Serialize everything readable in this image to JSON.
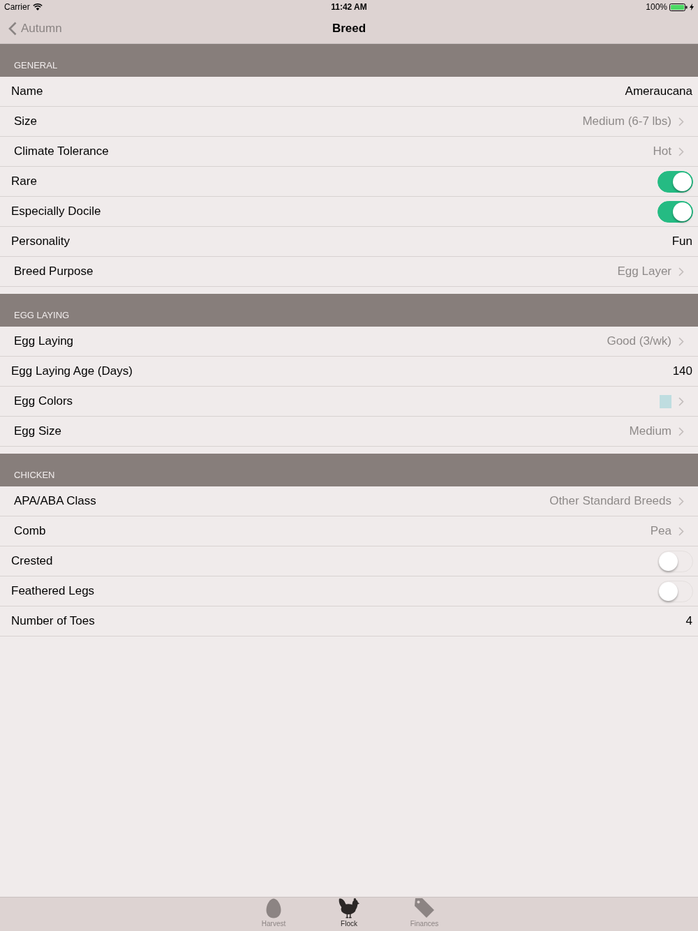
{
  "status_bar": {
    "carrier": "Carrier",
    "time": "11:42 AM",
    "battery": "100%"
  },
  "nav": {
    "back": "Autumn",
    "title": "Breed"
  },
  "sections": [
    {
      "title": "GENERAL",
      "rows": [
        {
          "kind": "text",
          "label": "Name",
          "value": "Ameraucana"
        },
        {
          "kind": "disclosure",
          "label": "Size",
          "value": "Medium (6-7 lbs)"
        },
        {
          "kind": "disclosure",
          "label": "Climate Tolerance",
          "value": "Hot"
        },
        {
          "kind": "toggle",
          "label": "Rare",
          "on": true
        },
        {
          "kind": "toggle",
          "label": "Especially Docile",
          "on": true
        },
        {
          "kind": "text",
          "label": "Personality",
          "value": "Fun"
        },
        {
          "kind": "disclosure",
          "label": "Breed Purpose",
          "value": "Egg Layer"
        }
      ]
    },
    {
      "title": "EGG LAYING",
      "rows": [
        {
          "kind": "disclosure",
          "label": "Egg Laying",
          "value": "Good (3/wk)"
        },
        {
          "kind": "text",
          "label": "Egg Laying Age (Days)",
          "value": "140"
        },
        {
          "kind": "color",
          "label": "Egg Colors",
          "color": "#bfdde0"
        },
        {
          "kind": "disclosure",
          "label": "Egg Size",
          "value": "Medium"
        }
      ]
    },
    {
      "title": "CHICKEN",
      "rows": [
        {
          "kind": "disclosure",
          "label": "APA/ABA Class",
          "value": "Other Standard Breeds"
        },
        {
          "kind": "disclosure",
          "label": "Comb",
          "value": "Pea"
        },
        {
          "kind": "toggle",
          "label": "Crested",
          "on": false
        },
        {
          "kind": "toggle",
          "label": "Feathered Legs",
          "on": false
        },
        {
          "kind": "text",
          "label": "Number of Toes",
          "value": "4"
        }
      ]
    }
  ],
  "tab_bar": [
    {
      "label": "Harvest",
      "selected": false
    },
    {
      "label": "Flock",
      "selected": true
    },
    {
      "label": "Finances",
      "selected": false
    }
  ]
}
